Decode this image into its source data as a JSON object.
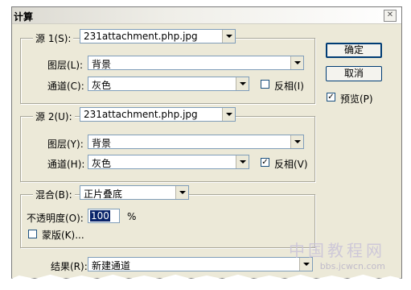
{
  "window": {
    "title": "计算",
    "close_glyph": "✕"
  },
  "source1": {
    "legend": "源 1(S):",
    "file": "231attachment.php.jpg",
    "layer_label": "图层(L):",
    "layer_value": "背景",
    "channel_label": "通道(C):",
    "channel_value": "灰色",
    "invert_label": "反相(I)",
    "invert_checked": false
  },
  "source2": {
    "legend": "源 2(U):",
    "file": "231attachment.php.jpg",
    "layer_label": "图层(Y):",
    "layer_value": "背景",
    "channel_label": "通道(H):",
    "channel_value": "灰色",
    "invert_label": "反相(V)",
    "invert_checked": true
  },
  "blending": {
    "label": "混合(B):",
    "mode": "正片叠底",
    "opacity_label": "不透明度(O):",
    "opacity_value": "100",
    "opacity_unit": "%",
    "mask_label": "蒙版(K)...",
    "mask_checked": false
  },
  "result": {
    "label": "结果(R):",
    "value": "新建通道"
  },
  "buttons": {
    "ok": "确定",
    "cancel": "取消"
  },
  "preview": {
    "label": "预览(P)",
    "checked": true
  },
  "checkmark": "✓",
  "watermark": {
    "line1": "中国教程网",
    "line2": "bbs.jcwcn.com"
  }
}
